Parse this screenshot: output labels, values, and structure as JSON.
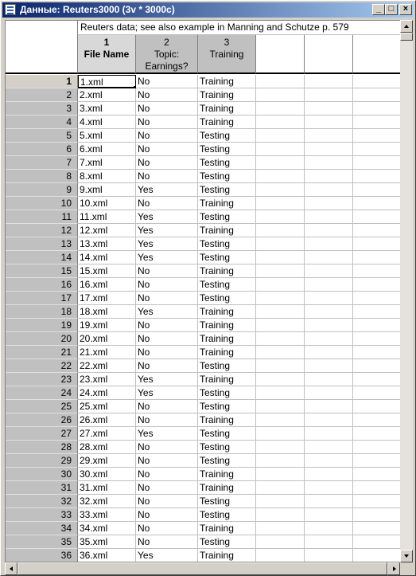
{
  "window": {
    "title": "Данные: Reuters3000 (3v * 3000c)",
    "minimize_glyph": "_",
    "maximize_glyph": "□",
    "close_glyph": "×"
  },
  "sheet": {
    "info": "Reuters data; see also example in Manning and Schutze p. 579",
    "columns": [
      {
        "num": "1",
        "name": "File Name"
      },
      {
        "num": "2",
        "name": "Topic:\nEarnings?"
      },
      {
        "num": "3",
        "name": "Training"
      }
    ],
    "rows": [
      [
        "1",
        "1.xml",
        "No",
        "Training"
      ],
      [
        "2",
        "2.xml",
        "No",
        "Training"
      ],
      [
        "3",
        "3.xml",
        "No",
        "Training"
      ],
      [
        "4",
        "4.xml",
        "No",
        "Training"
      ],
      [
        "5",
        "5.xml",
        "No",
        "Testing"
      ],
      [
        "6",
        "6.xml",
        "No",
        "Testing"
      ],
      [
        "7",
        "7.xml",
        "No",
        "Testing"
      ],
      [
        "8",
        "8.xml",
        "No",
        "Testing"
      ],
      [
        "9",
        "9.xml",
        "Yes",
        "Testing"
      ],
      [
        "10",
        "10.xml",
        "No",
        "Training"
      ],
      [
        "11",
        "11.xml",
        "Yes",
        "Testing"
      ],
      [
        "12",
        "12.xml",
        "Yes",
        "Training"
      ],
      [
        "13",
        "13.xml",
        "Yes",
        "Testing"
      ],
      [
        "14",
        "14.xml",
        "Yes",
        "Testing"
      ],
      [
        "15",
        "15.xml",
        "No",
        "Training"
      ],
      [
        "16",
        "16.xml",
        "No",
        "Testing"
      ],
      [
        "17",
        "17.xml",
        "No",
        "Testing"
      ],
      [
        "18",
        "18.xml",
        "Yes",
        "Training"
      ],
      [
        "19",
        "19.xml",
        "No",
        "Training"
      ],
      [
        "20",
        "20.xml",
        "No",
        "Training"
      ],
      [
        "21",
        "21.xml",
        "No",
        "Training"
      ],
      [
        "22",
        "22.xml",
        "No",
        "Testing"
      ],
      [
        "23",
        "23.xml",
        "Yes",
        "Training"
      ],
      [
        "24",
        "24.xml",
        "Yes",
        "Testing"
      ],
      [
        "25",
        "25.xml",
        "No",
        "Testing"
      ],
      [
        "26",
        "26.xml",
        "No",
        "Training"
      ],
      [
        "27",
        "27.xml",
        "Yes",
        "Testing"
      ],
      [
        "28",
        "28.xml",
        "No",
        "Testing"
      ],
      [
        "29",
        "29.xml",
        "No",
        "Testing"
      ],
      [
        "30",
        "30.xml",
        "No",
        "Training"
      ],
      [
        "31",
        "31.xml",
        "No",
        "Training"
      ],
      [
        "32",
        "32.xml",
        "No",
        "Testing"
      ],
      [
        "33",
        "33.xml",
        "No",
        "Testing"
      ],
      [
        "34",
        "34.xml",
        "No",
        "Training"
      ],
      [
        "35",
        "35.xml",
        "No",
        "Testing"
      ],
      [
        "36",
        "36.xml",
        "Yes",
        "Training"
      ]
    ]
  },
  "icons": {
    "app": "data-sheet-icon",
    "scroll_up": "up-arrow-icon",
    "scroll_down": "down-arrow-icon",
    "scroll_left": "left-arrow-icon",
    "scroll_right": "right-arrow-icon"
  },
  "colors": {
    "title_gradient_start": "#0a246a",
    "title_gradient_end": "#a6caf0",
    "header_gray": "#c0c0c0"
  }
}
